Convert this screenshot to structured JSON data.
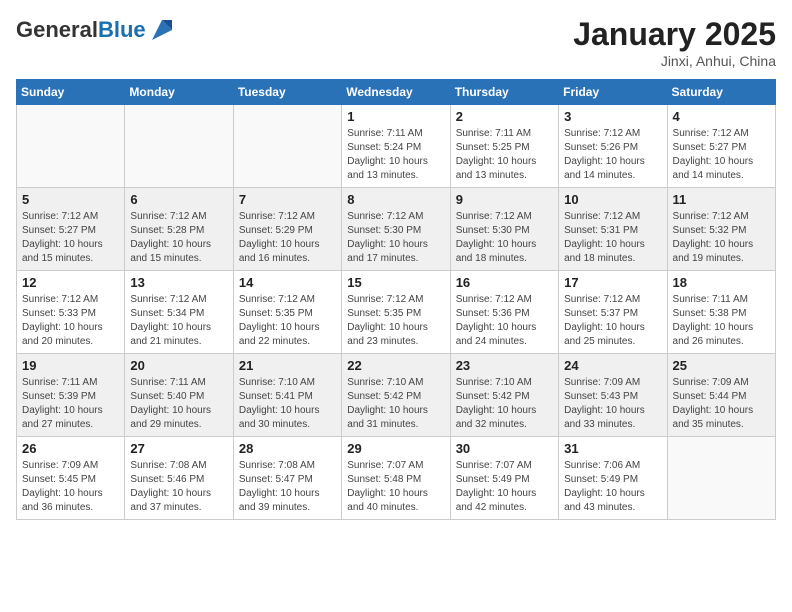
{
  "header": {
    "logo_general": "General",
    "logo_blue": "Blue",
    "month_title": "January 2025",
    "subtitle": "Jinxi, Anhui, China"
  },
  "weekdays": [
    "Sunday",
    "Monday",
    "Tuesday",
    "Wednesday",
    "Thursday",
    "Friday",
    "Saturday"
  ],
  "weeks": [
    {
      "shaded": false,
      "days": [
        {
          "number": "",
          "info": ""
        },
        {
          "number": "",
          "info": ""
        },
        {
          "number": "",
          "info": ""
        },
        {
          "number": "1",
          "info": "Sunrise: 7:11 AM\nSunset: 5:24 PM\nDaylight: 10 hours\nand 13 minutes."
        },
        {
          "number": "2",
          "info": "Sunrise: 7:11 AM\nSunset: 5:25 PM\nDaylight: 10 hours\nand 13 minutes."
        },
        {
          "number": "3",
          "info": "Sunrise: 7:12 AM\nSunset: 5:26 PM\nDaylight: 10 hours\nand 14 minutes."
        },
        {
          "number": "4",
          "info": "Sunrise: 7:12 AM\nSunset: 5:27 PM\nDaylight: 10 hours\nand 14 minutes."
        }
      ]
    },
    {
      "shaded": true,
      "days": [
        {
          "number": "5",
          "info": "Sunrise: 7:12 AM\nSunset: 5:27 PM\nDaylight: 10 hours\nand 15 minutes."
        },
        {
          "number": "6",
          "info": "Sunrise: 7:12 AM\nSunset: 5:28 PM\nDaylight: 10 hours\nand 15 minutes."
        },
        {
          "number": "7",
          "info": "Sunrise: 7:12 AM\nSunset: 5:29 PM\nDaylight: 10 hours\nand 16 minutes."
        },
        {
          "number": "8",
          "info": "Sunrise: 7:12 AM\nSunset: 5:30 PM\nDaylight: 10 hours\nand 17 minutes."
        },
        {
          "number": "9",
          "info": "Sunrise: 7:12 AM\nSunset: 5:30 PM\nDaylight: 10 hours\nand 18 minutes."
        },
        {
          "number": "10",
          "info": "Sunrise: 7:12 AM\nSunset: 5:31 PM\nDaylight: 10 hours\nand 18 minutes."
        },
        {
          "number": "11",
          "info": "Sunrise: 7:12 AM\nSunset: 5:32 PM\nDaylight: 10 hours\nand 19 minutes."
        }
      ]
    },
    {
      "shaded": false,
      "days": [
        {
          "number": "12",
          "info": "Sunrise: 7:12 AM\nSunset: 5:33 PM\nDaylight: 10 hours\nand 20 minutes."
        },
        {
          "number": "13",
          "info": "Sunrise: 7:12 AM\nSunset: 5:34 PM\nDaylight: 10 hours\nand 21 minutes."
        },
        {
          "number": "14",
          "info": "Sunrise: 7:12 AM\nSunset: 5:35 PM\nDaylight: 10 hours\nand 22 minutes."
        },
        {
          "number": "15",
          "info": "Sunrise: 7:12 AM\nSunset: 5:35 PM\nDaylight: 10 hours\nand 23 minutes."
        },
        {
          "number": "16",
          "info": "Sunrise: 7:12 AM\nSunset: 5:36 PM\nDaylight: 10 hours\nand 24 minutes."
        },
        {
          "number": "17",
          "info": "Sunrise: 7:12 AM\nSunset: 5:37 PM\nDaylight: 10 hours\nand 25 minutes."
        },
        {
          "number": "18",
          "info": "Sunrise: 7:11 AM\nSunset: 5:38 PM\nDaylight: 10 hours\nand 26 minutes."
        }
      ]
    },
    {
      "shaded": true,
      "days": [
        {
          "number": "19",
          "info": "Sunrise: 7:11 AM\nSunset: 5:39 PM\nDaylight: 10 hours\nand 27 minutes."
        },
        {
          "number": "20",
          "info": "Sunrise: 7:11 AM\nSunset: 5:40 PM\nDaylight: 10 hours\nand 29 minutes."
        },
        {
          "number": "21",
          "info": "Sunrise: 7:10 AM\nSunset: 5:41 PM\nDaylight: 10 hours\nand 30 minutes."
        },
        {
          "number": "22",
          "info": "Sunrise: 7:10 AM\nSunset: 5:42 PM\nDaylight: 10 hours\nand 31 minutes."
        },
        {
          "number": "23",
          "info": "Sunrise: 7:10 AM\nSunset: 5:42 PM\nDaylight: 10 hours\nand 32 minutes."
        },
        {
          "number": "24",
          "info": "Sunrise: 7:09 AM\nSunset: 5:43 PM\nDaylight: 10 hours\nand 33 minutes."
        },
        {
          "number": "25",
          "info": "Sunrise: 7:09 AM\nSunset: 5:44 PM\nDaylight: 10 hours\nand 35 minutes."
        }
      ]
    },
    {
      "shaded": false,
      "days": [
        {
          "number": "26",
          "info": "Sunrise: 7:09 AM\nSunset: 5:45 PM\nDaylight: 10 hours\nand 36 minutes."
        },
        {
          "number": "27",
          "info": "Sunrise: 7:08 AM\nSunset: 5:46 PM\nDaylight: 10 hours\nand 37 minutes."
        },
        {
          "number": "28",
          "info": "Sunrise: 7:08 AM\nSunset: 5:47 PM\nDaylight: 10 hours\nand 39 minutes."
        },
        {
          "number": "29",
          "info": "Sunrise: 7:07 AM\nSunset: 5:48 PM\nDaylight: 10 hours\nand 40 minutes."
        },
        {
          "number": "30",
          "info": "Sunrise: 7:07 AM\nSunset: 5:49 PM\nDaylight: 10 hours\nand 42 minutes."
        },
        {
          "number": "31",
          "info": "Sunrise: 7:06 AM\nSunset: 5:49 PM\nDaylight: 10 hours\nand 43 minutes."
        },
        {
          "number": "",
          "info": ""
        }
      ]
    }
  ]
}
